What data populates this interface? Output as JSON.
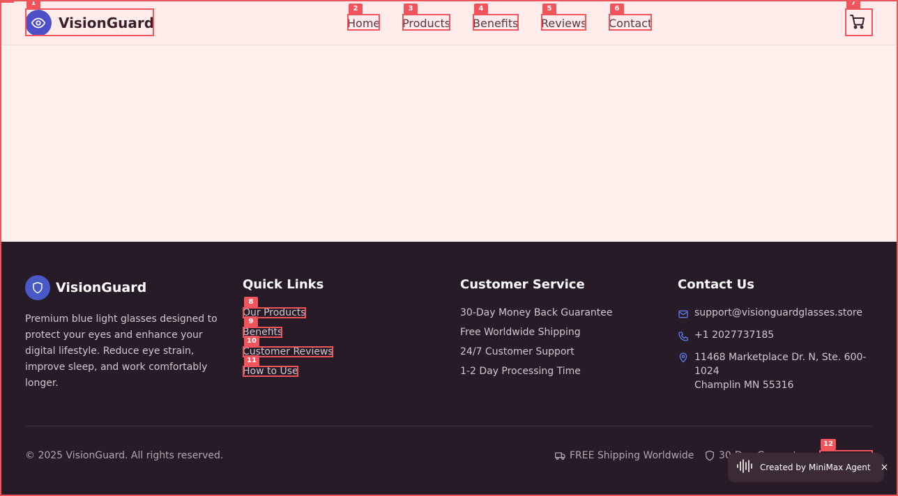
{
  "header": {
    "brand": "VisionGuard",
    "nav": [
      "Home",
      "Products",
      "Benefits",
      "Reviews",
      "Contact"
    ],
    "cart_icon": "cart-icon"
  },
  "footer": {
    "brand": "VisionGuard",
    "description": "Premium blue light glasses designed to protect your eyes and enhance your digital lifestyle. Reduce eye strain, improve sleep, and work comfortably longer.",
    "quick_links": {
      "title": "Quick Links",
      "items": [
        "Our Products",
        "Benefits",
        "Customer Reviews",
        "How to Use"
      ]
    },
    "customer_service": {
      "title": "Customer Service",
      "items": [
        "30-Day Money Back Guarantee",
        "Free Worldwide Shipping",
        "24/7 Customer Support",
        "1-2 Day Processing Time"
      ]
    },
    "contact": {
      "title": "Contact Us",
      "email": "support@visionguardglasses.store",
      "phone": "+1 2027737185",
      "address_line1": "11468 Marketplace Dr. N, Ste. 600-",
      "address_line2": "1024",
      "address_line3": "Champlin MN 55316"
    },
    "copyright": "© 2025 VisionGuard. All rights reserved.",
    "badges": [
      "FREE Shipping Worldwide",
      "30-Day Guarantee"
    ]
  },
  "toast": {
    "label": "Created by MiniMax Agent",
    "close": "×"
  },
  "overlay": {
    "tags": [
      "1",
      "2",
      "3",
      "4",
      "5",
      "6",
      "7",
      "8",
      "9",
      "10",
      "11",
      "12"
    ]
  },
  "colors": {
    "accent": "#4f4fc7",
    "footer_bg": "#281b28",
    "page_bg": "#fff0ee",
    "annotation": "#f2545b"
  }
}
